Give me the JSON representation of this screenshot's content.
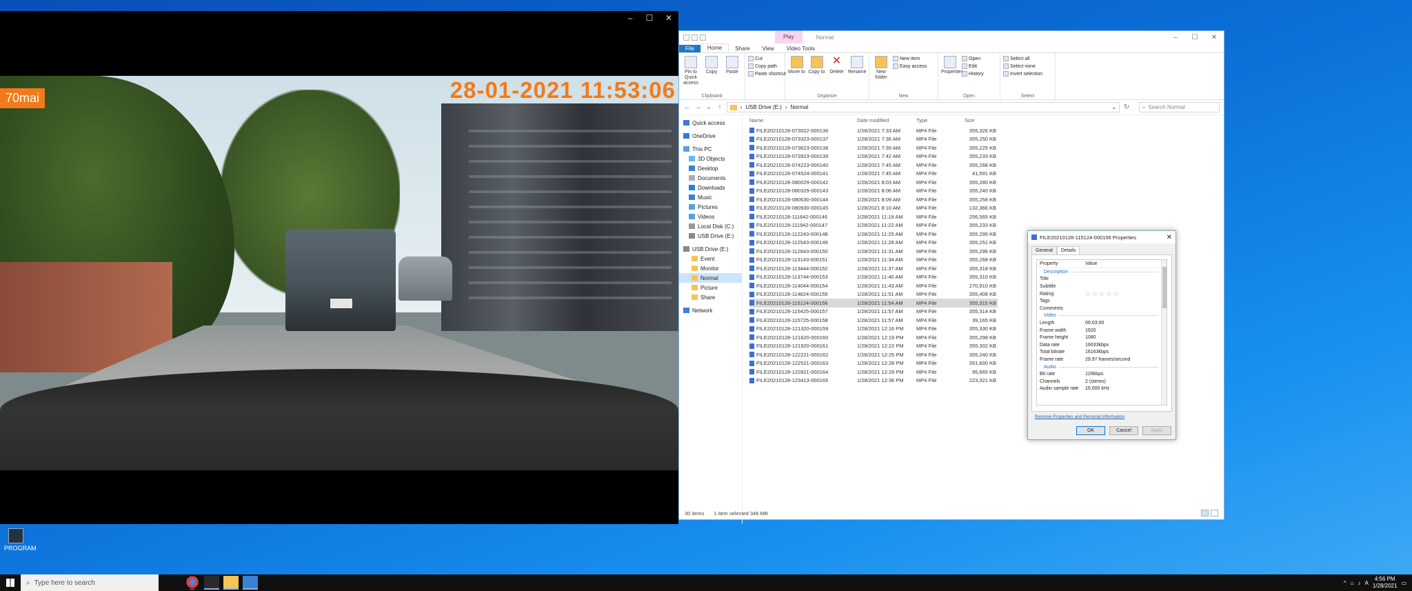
{
  "desktop": {
    "icon_label": "PROGRAM"
  },
  "player": {
    "brand": "70mai",
    "timestamp_overlay": "28-01-2021 11:53:06"
  },
  "explorer": {
    "context_tab": "Play",
    "title": "Normal",
    "tabs": [
      "File",
      "Home",
      "Share",
      "View",
      "Video Tools"
    ],
    "ribbon": {
      "clipboard": {
        "name": "Clipboard",
        "pin": "Pin to Quick access",
        "copy": "Copy",
        "paste": "Paste",
        "cut": "Cut",
        "copy_path": "Copy path",
        "paste_shortcut": "Paste shortcut"
      },
      "organize": {
        "name": "Organize",
        "move_to": "Move to",
        "copy_to": "Copy to",
        "delete": "Delete",
        "rename": "Rename"
      },
      "new": {
        "name": "New",
        "new_folder": "New folder",
        "new_item": "New item",
        "easy_access": "Easy access"
      },
      "open": {
        "name": "Open",
        "properties": "Properties",
        "open": "Open",
        "edit": "Edit",
        "history": "History"
      },
      "select": {
        "name": "Select",
        "select_all": "Select all",
        "select_none": "Select none",
        "invert": "Invert selection"
      }
    },
    "breadcrumb": [
      "USB Drive (E:)",
      "Normal"
    ],
    "search_placeholder": "Search Normal",
    "nav": {
      "quick_access": "Quick access",
      "onedrive": "OneDrive",
      "this_pc": "This PC",
      "objects3d": "3D Objects",
      "desktop": "Desktop",
      "documents": "Documents",
      "downloads": "Downloads",
      "music": "Music",
      "pictures": "Pictures",
      "videos": "Videos",
      "local_disk": "Local Disk (C:)",
      "usb1": "USB Drive (E:)",
      "usb2": "USB Drive (E:)",
      "event": "Event",
      "monitor": "Monitor",
      "normal": "Normal",
      "picture": "Picture",
      "share": "Share",
      "network": "Network"
    },
    "columns": {
      "name": "Name",
      "date": "Date modified",
      "type": "Type",
      "size": "Size"
    },
    "files": [
      {
        "name": "FILE20210128-073022-000136",
        "date": "1/28/2021 7:33 AM",
        "type": "MP4 File",
        "size": "355,326 KB"
      },
      {
        "name": "FILE20210128-073323-000137",
        "date": "1/28/2021 7:36 AM",
        "type": "MP4 File",
        "size": "355,250 KB"
      },
      {
        "name": "FILE20210128-073623-000138",
        "date": "1/28/2021 7:39 AM",
        "type": "MP4 File",
        "size": "355,225 KB"
      },
      {
        "name": "FILE20210128-073923-000139",
        "date": "1/28/2021 7:42 AM",
        "type": "MP4 File",
        "size": "355,233 KB"
      },
      {
        "name": "FILE20210128-074223-000140",
        "date": "1/28/2021 7:45 AM",
        "type": "MP4 File",
        "size": "355,268 KB"
      },
      {
        "name": "FILE20210128-074524-000141",
        "date": "1/28/2021 7:45 AM",
        "type": "MP4 File",
        "size": "41,591 KB"
      },
      {
        "name": "FILE20210128-080029-000142",
        "date": "1/28/2021 8:03 AM",
        "type": "MP4 File",
        "size": "355,280 KB"
      },
      {
        "name": "FILE20210128-080329-000143",
        "date": "1/28/2021 8:06 AM",
        "type": "MP4 File",
        "size": "355,240 KB"
      },
      {
        "name": "FILE20210128-080630-000144",
        "date": "1/28/2021 8:09 AM",
        "type": "MP4 File",
        "size": "355,258 KB"
      },
      {
        "name": "FILE20210128-080930-000145",
        "date": "1/28/2021 8:10 AM",
        "type": "MP4 File",
        "size": "132,366 KB"
      },
      {
        "name": "FILE20210128-111642-000146",
        "date": "1/28/2021 11:19 AM",
        "type": "MP4 File",
        "size": "256,565 KB"
      },
      {
        "name": "FILE20210128-111942-000147",
        "date": "1/28/2021 11:22 AM",
        "type": "MP4 File",
        "size": "355,233 KB"
      },
      {
        "name": "FILE20210128-112243-000148",
        "date": "1/28/2021 11:25 AM",
        "type": "MP4 File",
        "size": "355,295 KB"
      },
      {
        "name": "FILE20210128-112543-000149",
        "date": "1/28/2021 11:28 AM",
        "type": "MP4 File",
        "size": "355,251 KB"
      },
      {
        "name": "FILE20210128-112843-000150",
        "date": "1/28/2021 11:31 AM",
        "type": "MP4 File",
        "size": "355,296 KB"
      },
      {
        "name": "FILE20210128-113143-000151",
        "date": "1/28/2021 11:34 AM",
        "type": "MP4 File",
        "size": "355,268 KB"
      },
      {
        "name": "FILE20210128-113444-000152",
        "date": "1/28/2021 11:37 AM",
        "type": "MP4 File",
        "size": "355,318 KB"
      },
      {
        "name": "FILE20210128-113744-000153",
        "date": "1/28/2021 11:40 AM",
        "type": "MP4 File",
        "size": "355,310 KB"
      },
      {
        "name": "FILE20210128-114044-000154",
        "date": "1/28/2021 11:43 AM",
        "type": "MP4 File",
        "size": "270,910 KB"
      },
      {
        "name": "FILE20210128-114824-000155",
        "date": "1/28/2021 11:51 AM",
        "type": "MP4 File",
        "size": "355,408 KB"
      },
      {
        "name": "FILE20210128-115124-000156",
        "date": "1/28/2021 11:54 AM",
        "type": "MP4 File",
        "size": "355,315 KB"
      },
      {
        "name": "FILE20210128-115425-000157",
        "date": "1/28/2021 11:57 AM",
        "type": "MP4 File",
        "size": "355,314 KB"
      },
      {
        "name": "FILE20210128-115725-000158",
        "date": "1/28/2021 11:57 AM",
        "type": "MP4 File",
        "size": "39,165 KB"
      },
      {
        "name": "FILE20210128-121320-000159",
        "date": "1/28/2021 12:16 PM",
        "type": "MP4 File",
        "size": "355,330 KB"
      },
      {
        "name": "FILE20210128-121620-000160",
        "date": "1/28/2021 12:19 PM",
        "type": "MP4 File",
        "size": "355,298 KB"
      },
      {
        "name": "FILE20210128-121920-000161",
        "date": "1/28/2021 12:22 PM",
        "type": "MP4 File",
        "size": "355,302 KB"
      },
      {
        "name": "FILE20210128-122221-000162",
        "date": "1/28/2021 12:25 PM",
        "type": "MP4 File",
        "size": "355,240 KB"
      },
      {
        "name": "FILE20210128-122521-000163",
        "date": "1/28/2021 12:28 PM",
        "type": "MP4 File",
        "size": "351,600 KB"
      },
      {
        "name": "FILE20210128-122821-000164",
        "date": "1/28/2021 12:29 PM",
        "type": "MP4 File",
        "size": "95,665 KB"
      },
      {
        "name": "FILE20210128-123413-000165",
        "date": "1/28/2021 12:36 PM",
        "type": "MP4 File",
        "size": "223,321 KB"
      }
    ],
    "selected_index": 20,
    "status": {
      "items": "30 items",
      "selected": "1 item selected  346 MB"
    }
  },
  "properties": {
    "title": "FILE20210128-115124-000156 Properties",
    "tabs": [
      "General",
      "Details"
    ],
    "head_property": "Property",
    "head_value": "Value",
    "sections": {
      "description": "Description",
      "video": "Video",
      "audio": "Audio"
    },
    "desc_rows": [
      {
        "k": "Title",
        "v": ""
      },
      {
        "k": "Subtitle",
        "v": ""
      },
      {
        "k": "Rating",
        "v": "☆☆☆☆☆"
      },
      {
        "k": "Tags",
        "v": ""
      },
      {
        "k": "Comments",
        "v": ""
      }
    ],
    "video_rows": [
      {
        "k": "Length",
        "v": "00:03:00"
      },
      {
        "k": "Frame width",
        "v": "1920"
      },
      {
        "k": "Frame height",
        "v": "1080"
      },
      {
        "k": "Data rate",
        "v": "16033kbps"
      },
      {
        "k": "Total bitrate",
        "v": "16163kbps"
      },
      {
        "k": "Frame rate",
        "v": "29.97 frames/second"
      }
    ],
    "audio_rows": [
      {
        "k": "Bit rate",
        "v": "129kbps"
      },
      {
        "k": "Channels",
        "v": "2 (stereo)"
      },
      {
        "k": "Audio sample rate",
        "v": "16.000 kHz"
      }
    ],
    "link": "Remove Properties and Personal Information",
    "ok": "OK",
    "cancel": "Cancel",
    "apply": "Apply"
  },
  "taskbar": {
    "search_placeholder": "Type here to search",
    "time": "4:56 PM",
    "date": "1/28/2021"
  }
}
